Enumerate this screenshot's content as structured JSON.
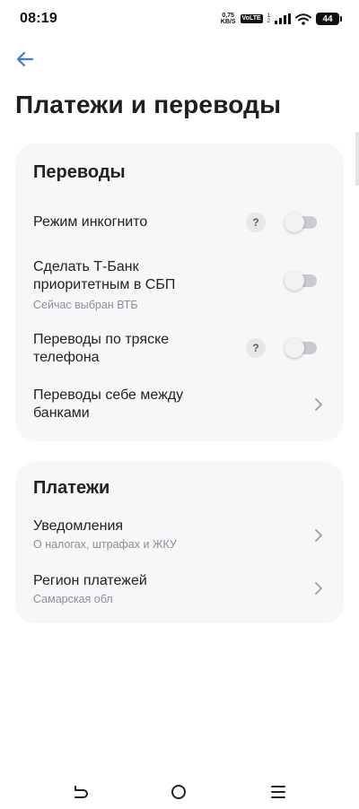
{
  "status_bar": {
    "time": "08:19",
    "net_speed_value": "0,75",
    "net_speed_unit": "KB/S",
    "volte": "VoLTE",
    "battery": "44"
  },
  "header": {
    "title": "Платежи и переводы"
  },
  "transfers": {
    "title": "Переводы",
    "incognito": {
      "label": "Режим инкогнито",
      "help": "?",
      "enabled": false
    },
    "priority_sbp": {
      "label": "Сделать Т-Банк приоритетным в СБП",
      "subtitle": "Сейчас выбран ВТБ",
      "enabled": false
    },
    "shake": {
      "label": "Переводы по тряске телефона",
      "help": "?",
      "enabled": false
    },
    "self_transfer": {
      "label": "Переводы себе между банками"
    }
  },
  "payments": {
    "title": "Платежи",
    "notifications": {
      "label": "Уведомления",
      "subtitle": "О налогах, штрафах и ЖКУ"
    },
    "region": {
      "label": "Регион платежей",
      "subtitle": "Самарская обл"
    }
  },
  "colors": {
    "accent": "#3d7be0",
    "card_bg": "#f6f7f8",
    "toggle_off": "#c9cbcf"
  }
}
